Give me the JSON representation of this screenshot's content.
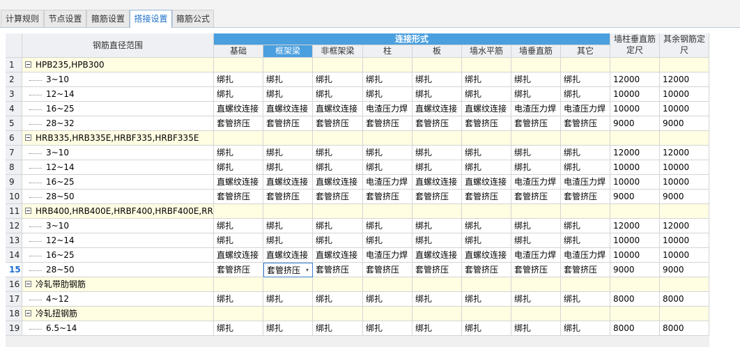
{
  "tabs": [
    {
      "label": "计算规则",
      "active": false
    },
    {
      "label": "节点设置",
      "active": false
    },
    {
      "label": "箍筋设置",
      "active": false
    },
    {
      "label": "搭接设置",
      "active": true
    },
    {
      "label": "箍筋公式",
      "active": false
    }
  ],
  "grid": {
    "range_header": "钢筋直径范围",
    "group_header": "连接形式",
    "sub_headers": [
      "基础",
      "框架梁",
      "非框架梁",
      "柱",
      "板",
      "墙水平筋",
      "墙垂直筋",
      "其它"
    ],
    "selected_sub_header": 1,
    "extra_headers": [
      {
        "line1": "墙柱垂直筋",
        "line2": "定尺"
      },
      {
        "line1": "其余钢筋定",
        "line2": "尺"
      }
    ],
    "current_row": 15,
    "rows": [
      {
        "num": "1",
        "group": true,
        "label": "HPB235,HPB300"
      },
      {
        "num": "2",
        "label": "3~10",
        "cells": [
          "绑扎",
          "绑扎",
          "绑扎",
          "绑扎",
          "绑扎",
          "绑扎",
          "绑扎",
          "绑扎",
          "12000",
          "12000"
        ]
      },
      {
        "num": "3",
        "label": "12~14",
        "cells": [
          "绑扎",
          "绑扎",
          "绑扎",
          "绑扎",
          "绑扎",
          "绑扎",
          "绑扎",
          "绑扎",
          "10000",
          "10000"
        ]
      },
      {
        "num": "4",
        "label": "16~25",
        "cells": [
          "直螺纹连接",
          "直螺纹连接",
          "直螺纹连接",
          "电渣压力焊",
          "直螺纹连接",
          "直螺纹连接",
          "电渣压力焊",
          "电渣压力焊",
          "10000",
          "10000"
        ]
      },
      {
        "num": "5",
        "label": "28~32",
        "cells": [
          "套管挤压",
          "套管挤压",
          "套管挤压",
          "套管挤压",
          "套管挤压",
          "套管挤压",
          "套管挤压",
          "套管挤压",
          "9000",
          "9000"
        ]
      },
      {
        "num": "6",
        "group": true,
        "label": "HRB335,HRB335E,HRBF335,HRBF335E"
      },
      {
        "num": "7",
        "label": "3~10",
        "cells": [
          "绑扎",
          "绑扎",
          "绑扎",
          "绑扎",
          "绑扎",
          "绑扎",
          "绑扎",
          "绑扎",
          "12000",
          "12000"
        ]
      },
      {
        "num": "8",
        "label": "12~14",
        "cells": [
          "绑扎",
          "绑扎",
          "绑扎",
          "绑扎",
          "绑扎",
          "绑扎",
          "绑扎",
          "绑扎",
          "10000",
          "10000"
        ]
      },
      {
        "num": "9",
        "label": "16~25",
        "cells": [
          "直螺纹连接",
          "直螺纹连接",
          "直螺纹连接",
          "电渣压力焊",
          "直螺纹连接",
          "直螺纹连接",
          "电渣压力焊",
          "电渣压力焊",
          "10000",
          "10000"
        ]
      },
      {
        "num": "10",
        "label": "28~50",
        "cells": [
          "套管挤压",
          "套管挤压",
          "套管挤压",
          "套管挤压",
          "套管挤压",
          "套管挤压",
          "套管挤压",
          "套管挤压",
          "9000",
          "9000"
        ]
      },
      {
        "num": "11",
        "group": true,
        "label": "HRB400,HRB400E,HRBF400,HRBF400E,RR..."
      },
      {
        "num": "12",
        "label": "3~10",
        "cells": [
          "绑扎",
          "绑扎",
          "绑扎",
          "绑扎",
          "绑扎",
          "绑扎",
          "绑扎",
          "绑扎",
          "12000",
          "12000"
        ]
      },
      {
        "num": "13",
        "label": "12~14",
        "cells": [
          "绑扎",
          "绑扎",
          "绑扎",
          "绑扎",
          "绑扎",
          "绑扎",
          "绑扎",
          "绑扎",
          "10000",
          "10000"
        ]
      },
      {
        "num": "14",
        "label": "16~25",
        "cells": [
          "直螺纹连接",
          "直螺纹连接",
          "直螺纹连接",
          "电渣压力焊",
          "直螺纹连接",
          "直螺纹连接",
          "电渣压力焊",
          "电渣压力焊",
          "10000",
          "10000"
        ]
      },
      {
        "num": "15",
        "label": "28~50",
        "cells": [
          "套管挤压",
          "套管挤压",
          "套管挤压",
          "套管挤压",
          "套管挤压",
          "套管挤压",
          "套管挤压",
          "套管挤压",
          "9000",
          "9000"
        ]
      },
      {
        "num": "16",
        "group": true,
        "label": "冷轧带肋钢筋"
      },
      {
        "num": "17",
        "label": "4~12",
        "cells": [
          "绑扎",
          "绑扎",
          "绑扎",
          "绑扎",
          "绑扎",
          "绑扎",
          "绑扎",
          "绑扎",
          "8000",
          "8000"
        ]
      },
      {
        "num": "18",
        "group": true,
        "label": "冷轧扭钢筋"
      },
      {
        "num": "19",
        "label": "6.5~14",
        "cells": [
          "绑扎",
          "绑扎",
          "绑扎",
          "绑扎",
          "绑扎",
          "绑扎",
          "绑扎",
          "绑扎",
          "8000",
          "8000"
        ]
      }
    ],
    "editing_cell": {
      "row": 15,
      "col": 1
    },
    "dropdown_icon": "chevron-down-icon",
    "colors": {
      "header_blue": "#4a9fdf",
      "group_row": "#fffde2",
      "active_tab_text": "#1e72c8"
    }
  }
}
